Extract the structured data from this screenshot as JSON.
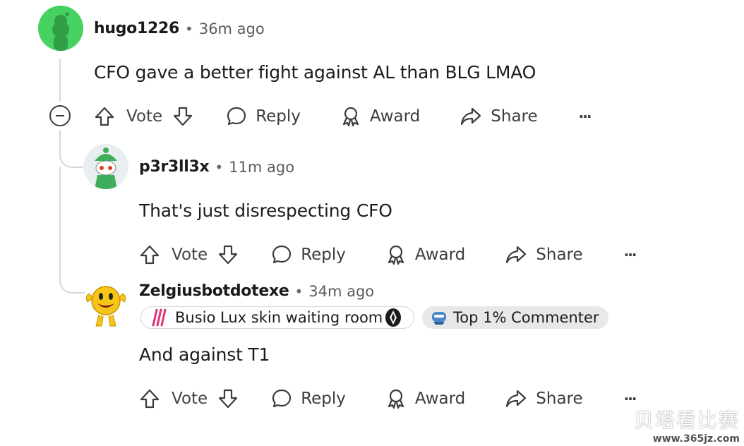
{
  "comments": [
    {
      "username": "hugo1226",
      "time": "36m ago",
      "body": "CFO gave a better fight against AL than BLG LMAO",
      "actions": {
        "vote": "Vote",
        "reply": "Reply",
        "award": "Award",
        "share": "Share"
      }
    },
    {
      "username": "p3r3ll3x",
      "time": "11m ago",
      "body": "That's just disrespecting CFO",
      "actions": {
        "vote": "Vote",
        "reply": "Reply",
        "award": "Award",
        "share": "Share"
      }
    },
    {
      "username": "Zelgiusbotdotexe",
      "time": "34m ago",
      "flairs": [
        "Busio Lux skin waiting room",
        "Top 1% Commenter"
      ],
      "body": "And against T1",
      "actions": {
        "vote": "Vote",
        "reply": "Reply",
        "award": "Award",
        "share": "Share"
      }
    }
  ],
  "separator": "•",
  "more_glyph": "···",
  "watermark": {
    "line1": "贝塔看比赛",
    "line2": "www.365jz.com"
  },
  "colors": {
    "avatar1": "#46d160",
    "accent_flair": "#e8e8ea",
    "thread": "#d8d8d8"
  }
}
